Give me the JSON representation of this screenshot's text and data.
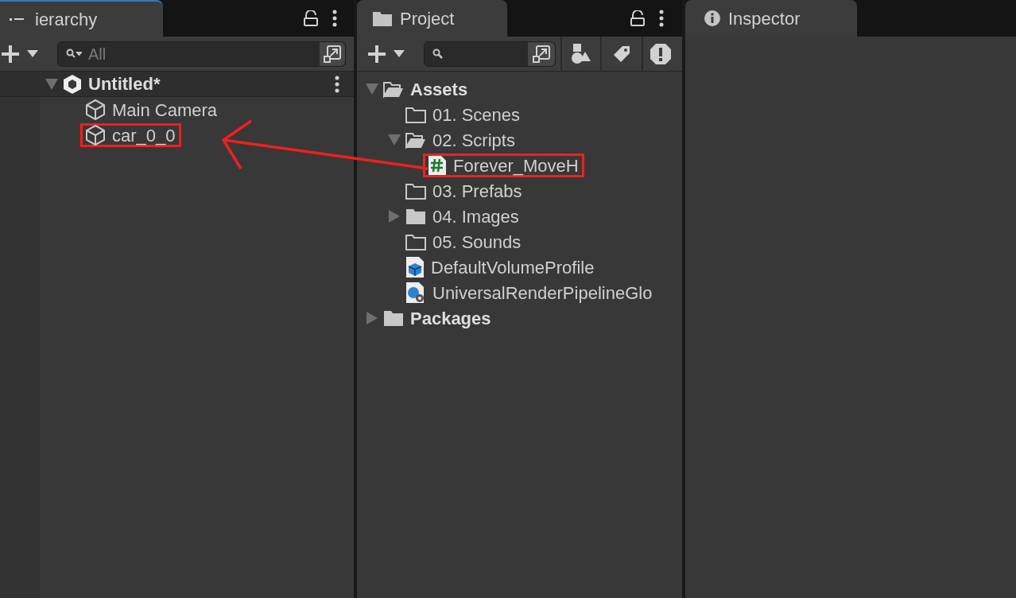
{
  "hierarchy": {
    "tab": {
      "label": "ierarchy",
      "selected": true
    },
    "search": {
      "placeholder": "All"
    },
    "tree": [
      {
        "label": "Untitled*",
        "kind": "scene",
        "expanded": true,
        "highlighted": false,
        "children": [
          {
            "label": "Main Camera",
            "kind": "object",
            "highlighted": false
          },
          {
            "label": "car_0_0",
            "kind": "object",
            "highlighted": true
          }
        ]
      }
    ]
  },
  "project": {
    "tab": {
      "label": "Project",
      "selected": false
    },
    "tree": [
      {
        "label": "Assets",
        "kind": "folder",
        "expanded": true,
        "highlighted": false,
        "children": [
          {
            "label": "01. Scenes",
            "kind": "empty-folder",
            "highlighted": false
          },
          {
            "label": "02. Scripts",
            "kind": "folder",
            "expanded": true,
            "highlighted": false,
            "children": [
              {
                "label": "Forever_MoveH",
                "kind": "script",
                "highlighted": true
              }
            ]
          },
          {
            "label": "03. Prefabs",
            "kind": "empty-folder",
            "highlighted": false
          },
          {
            "label": "04. Images",
            "kind": "folder",
            "expanded": false,
            "highlighted": false
          },
          {
            "label": "05. Sounds",
            "kind": "empty-folder",
            "highlighted": false
          },
          {
            "label": "DefaultVolumeProfile",
            "kind": "profile",
            "highlighted": false
          },
          {
            "label": "UniversalRenderPipelineGlo",
            "kind": "pipeline",
            "highlighted": false
          }
        ]
      },
      {
        "label": "Packages",
        "kind": "folder",
        "expanded": false,
        "highlighted": false
      }
    ]
  },
  "inspector": {
    "tab": {
      "label": "Inspector",
      "selected": false
    }
  }
}
